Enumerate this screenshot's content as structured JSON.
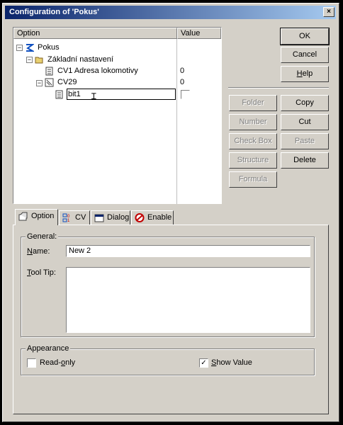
{
  "window": {
    "title": "Configuration of 'Pokus'",
    "close": "×"
  },
  "tree": {
    "columns": [
      "Option",
      "Value"
    ],
    "rows": [
      {
        "label": "Pokus",
        "value": ""
      },
      {
        "label": "Základní nastavení",
        "value": ""
      },
      {
        "label": "CV1 Adresa lokomotivy",
        "value": "0"
      },
      {
        "label": "CV29",
        "value": "0"
      },
      {
        "label": "bit1",
        "value": ""
      }
    ]
  },
  "buttons": {
    "ok": "OK",
    "cancel": "Cancel",
    "help": "Help",
    "folder": "Folder",
    "copy": "Copy",
    "number": "Number",
    "cut": "Cut",
    "checkbox": "Check Box",
    "paste": "Paste",
    "structure": "Structure",
    "delete": "Delete",
    "formula": "Formula"
  },
  "tabs": [
    "Option",
    "CV",
    "Dialog",
    "Enable"
  ],
  "general": {
    "group": "General:",
    "name_label": "Name:",
    "name_value": "New 2",
    "tooltip_label": "Tool Tip:",
    "tooltip_value": ""
  },
  "appearance": {
    "group": "Appearance",
    "readonly_label": "Read-only",
    "readonly_checked": false,
    "showvalue_label": "Show Value",
    "showvalue_checked": true
  }
}
